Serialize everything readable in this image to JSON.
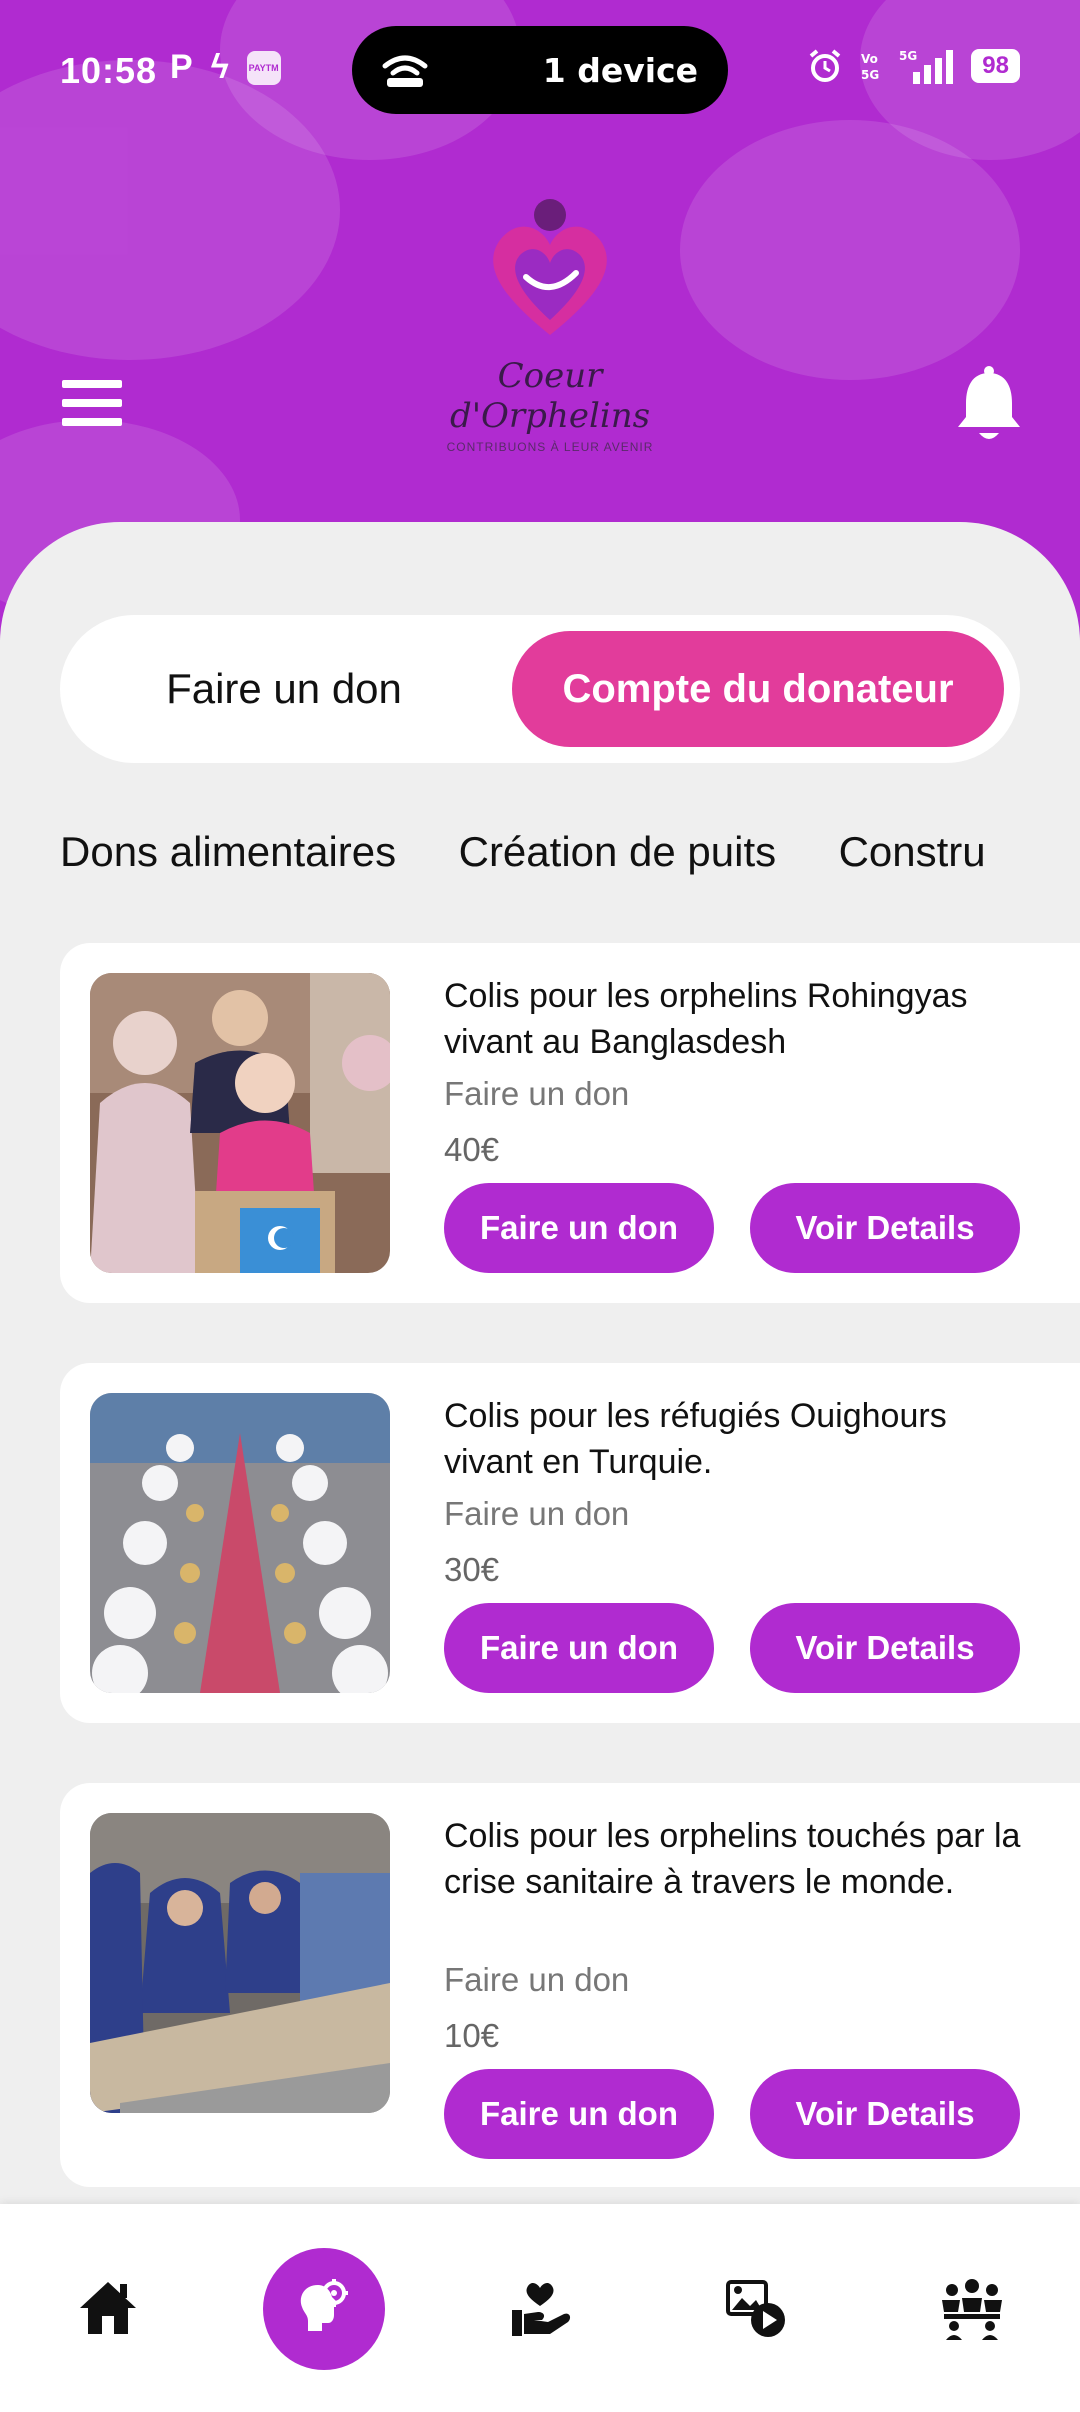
{
  "status_bar": {
    "time": "10:58",
    "left_icons": [
      "p-icon",
      "k-icon",
      "paytm-icon"
    ],
    "paytm_label": "PAYTM",
    "hotspot_label": "1 device",
    "right_icons": [
      "alarm-icon",
      "volte-icon",
      "5g-signal-icon"
    ],
    "battery": "98"
  },
  "header": {
    "brand_color": "#b02bd0",
    "logo_title": "Coeur d'Orphelins",
    "logo_subtitle": "CONTRIBUONS À LEUR AVENIR"
  },
  "segment": {
    "left_label": "Faire un don",
    "right_label": "Compte du donateur",
    "active_color": "#e23c9b"
  },
  "categories": [
    "Dons alimentaires",
    "Création de puits",
    "Constru"
  ],
  "cards": [
    {
      "title": "Colis pour les orphelins Rohingyas vivant au Banglasdesh",
      "subtitle": "Faire un don",
      "price": "40€",
      "donate_label": "Faire un don",
      "details_label": "Voir Details"
    },
    {
      "title": "Colis pour les réfugiés Ouighours vivant en Turquie.",
      "subtitle": "Faire un don",
      "price": "30€",
      "donate_label": "Faire un don",
      "details_label": "Voir Details"
    },
    {
      "title": "Colis pour les orphelins touchés par la crise sanitaire à travers le monde.",
      "subtitle": "Faire un don",
      "price": "10€",
      "donate_label": "Faire un don",
      "details_label": "Voir Details"
    }
  ],
  "bottom_nav": {
    "items": [
      "home-icon",
      "ideas-icon",
      "donate-hand-heart-icon",
      "media-icon",
      "community-icon"
    ],
    "active_index": 1
  }
}
